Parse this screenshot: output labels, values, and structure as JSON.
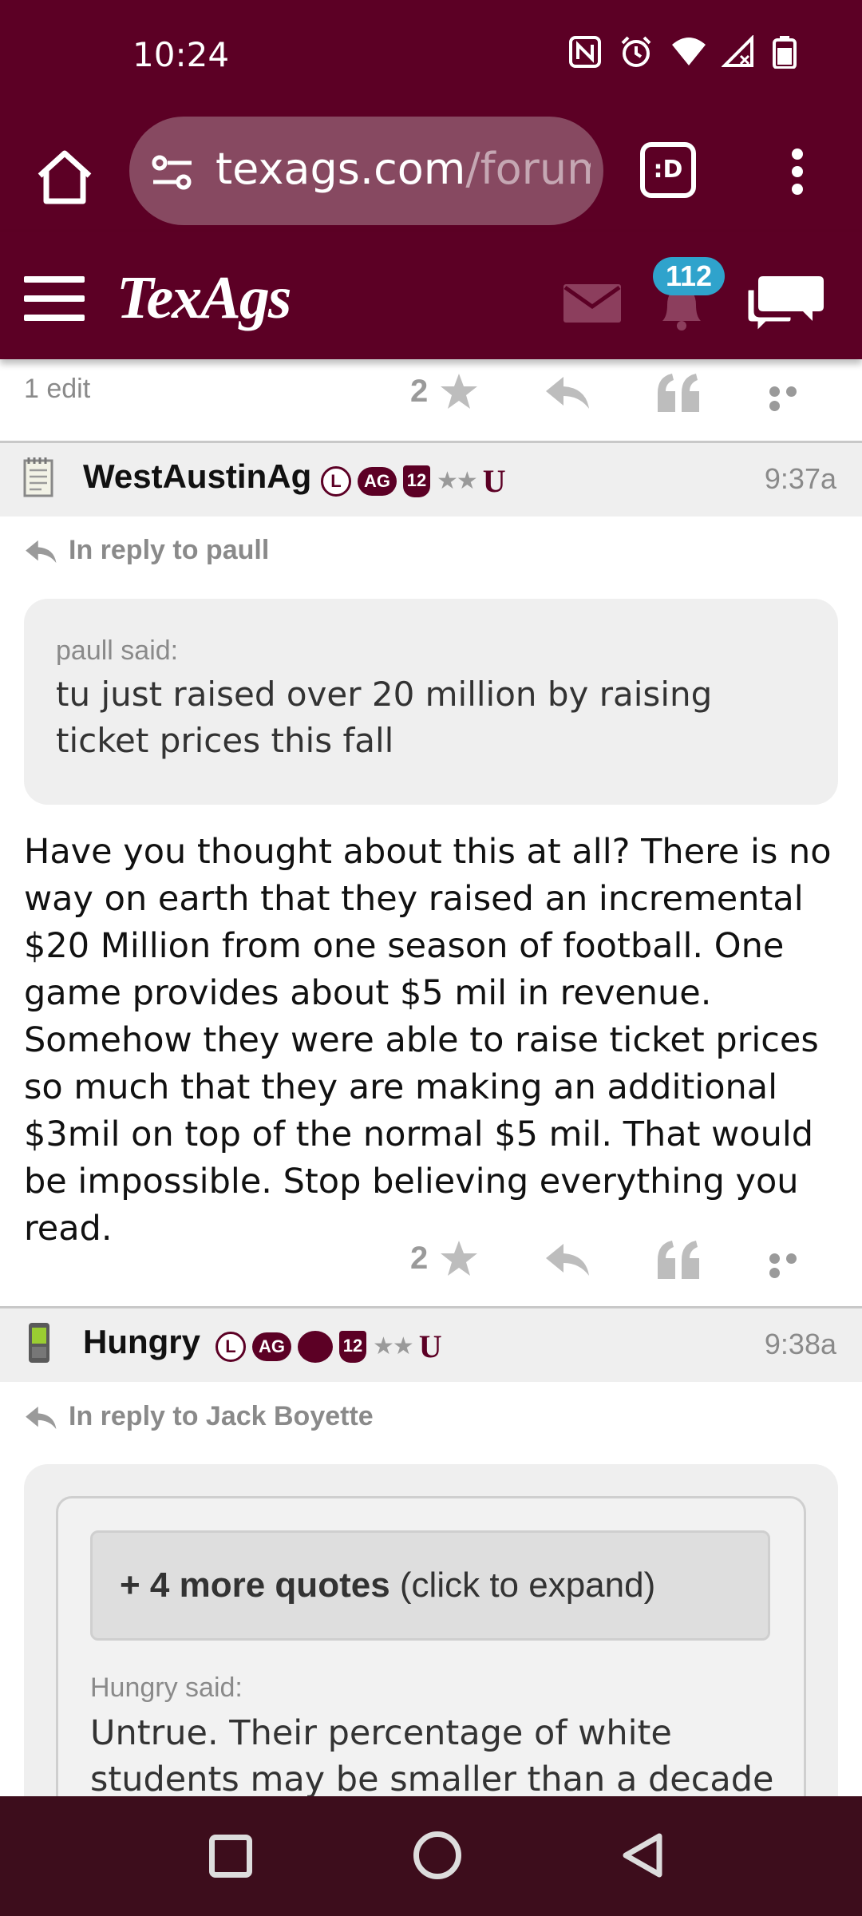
{
  "status": {
    "time": "10:24",
    "icons": [
      "nfc-icon",
      "alarm-icon",
      "wifi-icon",
      "cell-signal-icon",
      "battery-icon"
    ]
  },
  "browser": {
    "url_domain": "texags.com",
    "url_path": "/forum",
    "tab_button_label": ":D"
  },
  "site": {
    "logo_text": "TexAgs",
    "notification_count": "112",
    "brand_color": "#5c0025",
    "badge_color": "#2fa3cc"
  },
  "previous_post": {
    "edit_label": "1 edit",
    "like_count": "2"
  },
  "posts": [
    {
      "username": "WestAustinAg",
      "badges": [
        "L",
        "AG",
        "12",
        "★★",
        "U"
      ],
      "time": "9:37a",
      "reply_prefix": "In reply to",
      "reply_to": "paull",
      "quote_author": "paull said:",
      "quote_text": "tu just raised over 20 million by raising ticket prices this fall",
      "body": "Have you thought about this at all? There is no way on earth that they raised an incremental $20 Million from one season of football. One game provides about $5 mil in revenue. Somehow they were able to raise ticket prices so much that they are making an additional $3mil on top of the normal $5 mil. That would be impossible. Stop believing everything you read.",
      "like_count": "2"
    },
    {
      "username": "Hungry",
      "badges": [
        "L",
        "AG",
        "12",
        "★★",
        "U"
      ],
      "time": "9:38a",
      "reply_prefix": "In reply to",
      "reply_to": "Jack Boyette",
      "expand_bold": "+ 4 more quotes",
      "expand_rest": " (click to expand)",
      "quote_author": "Hungry said:",
      "quote_text": "Untrue. Their percentage of white students may be smaller than a decade"
    }
  ]
}
